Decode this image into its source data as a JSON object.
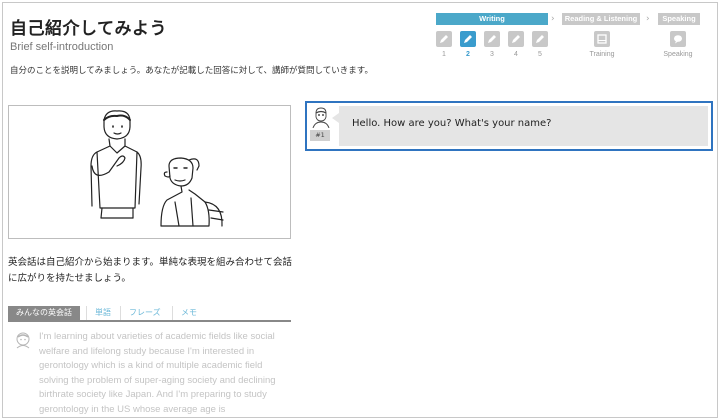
{
  "header": {
    "title": "自己紹介してみよう",
    "subtitle": "Brief self-introduction",
    "instruction": "自分のことを説明してみましょう。あなたが記載した回答に対して、講師が質問していきます。"
  },
  "progress": {
    "phases": [
      "Writing",
      "Reading & Listening",
      "Speaking"
    ],
    "active_phase": "Writing",
    "steps": [
      "1",
      "2",
      "3",
      "4",
      "5"
    ],
    "active_step": "2",
    "reading_step_label": "Training",
    "speaking_step_label": "Speaking"
  },
  "lesson": {
    "description": "英会話は自己紹介から始まります。単純な表現を組み合わせて会話に広がりを持たせましょう。"
  },
  "tabs": {
    "items": [
      "みんなの英会話",
      "単語",
      "フレーズ",
      "メモ"
    ],
    "active": "みんなの英会話"
  },
  "post": {
    "text": "I'm learning about varieties of academic fields like social welfare and lifelong study because I'm interested in gerontology which is a kind of multiple academic field solving the problem of super-aging society and declining birthrate society like Japan. And I'm preparing to study gerontology in the US whose average age is"
  },
  "chat": {
    "badge": "#1",
    "message": "Hello. How are you? What's your name?"
  },
  "colors": {
    "accent": "#4ba8c9",
    "active_step": "#3a9ccd",
    "selected_border": "#2f74c0",
    "bubble": "#e5e5e5",
    "inactive": "#c8c8c8"
  },
  "icons": {
    "step": "pencil-icon",
    "training": "book-icon",
    "speaking": "speech-icon"
  }
}
